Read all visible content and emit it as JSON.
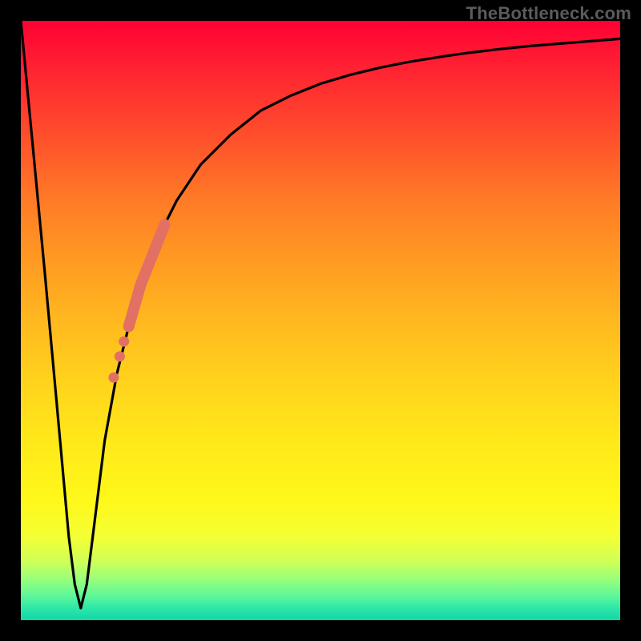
{
  "watermark": "TheBottleneck.com",
  "colors": {
    "frame": "#000000",
    "curve": "#000000",
    "marker": "#e27064",
    "gradient_stops": [
      "#ff0033",
      "#ff1a33",
      "#ff3a2e",
      "#ff5a2a",
      "#ff7b26",
      "#ff9a22",
      "#ffb81f",
      "#ffd21c",
      "#ffe81a",
      "#fff81a",
      "#f4ff34",
      "#d2ff55",
      "#9cff7a",
      "#5cf79a",
      "#2ce7a8",
      "#12d6a8"
    ]
  },
  "chart_data": {
    "type": "line",
    "title": "",
    "xlabel": "",
    "ylabel": "",
    "xlim": [
      0,
      100
    ],
    "ylim": [
      0,
      100
    ],
    "grid": false,
    "legend": false,
    "series": [
      {
        "name": "bottleneck-curve",
        "x": [
          0,
          2,
          4,
          6,
          8,
          9,
          10,
          11,
          12,
          14,
          16,
          18,
          20,
          22,
          24,
          26,
          30,
          35,
          40,
          45,
          50,
          55,
          60,
          65,
          70,
          75,
          80,
          85,
          90,
          95,
          100
        ],
        "y": [
          100,
          79,
          58,
          36,
          14,
          6,
          2,
          6,
          14,
          30,
          41,
          49,
          56,
          61,
          66,
          70,
          76,
          81,
          85,
          87.5,
          89.5,
          91,
          92.2,
          93.2,
          94,
          94.7,
          95.3,
          95.8,
          96.2,
          96.6,
          97
        ]
      }
    ],
    "annotations": {
      "highlighted_segment": {
        "description": "thick pink stroke overlaid on curve",
        "x_range": [
          18,
          24
        ],
        "endpoints_xy": [
          [
            18,
            49
          ],
          [
            24,
            66
          ]
        ]
      },
      "dots": [
        {
          "x": 16.5,
          "y": 44
        },
        {
          "x": 17.2,
          "y": 46.5
        },
        {
          "x": 15.5,
          "y": 40.5
        }
      ]
    }
  }
}
